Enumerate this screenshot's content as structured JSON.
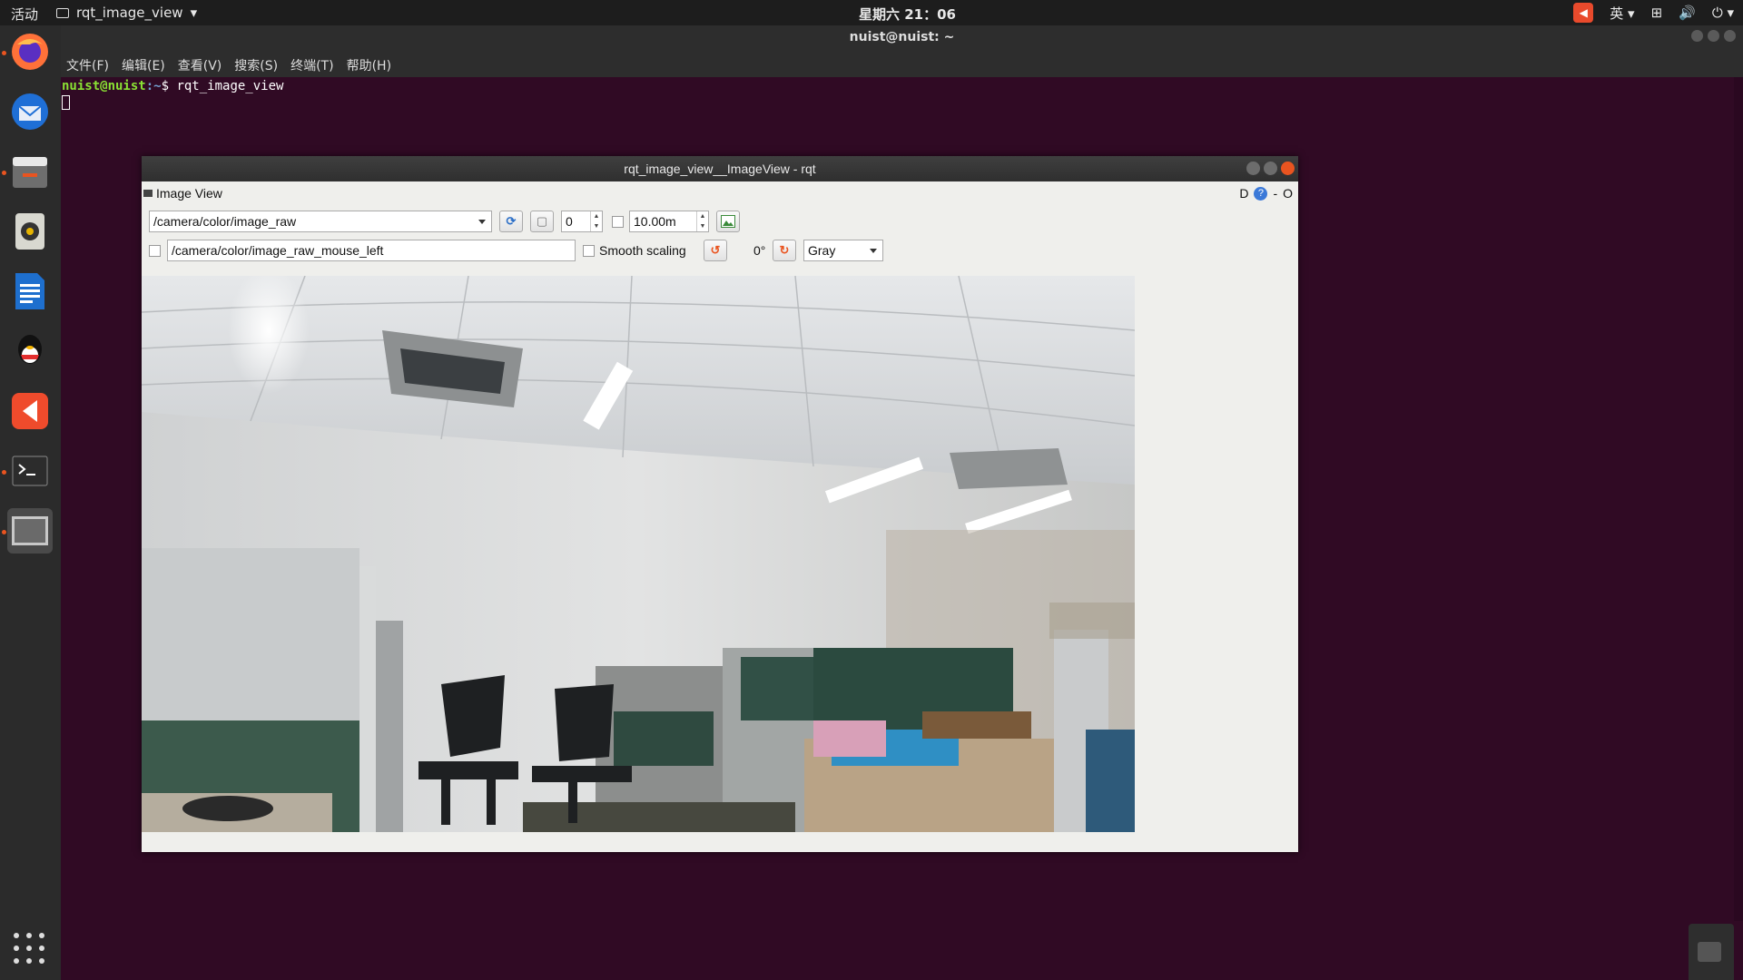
{
  "topbar": {
    "activities": "活动",
    "app_name": "rqt_image_view",
    "app_arrow": "▾",
    "clock": "星期六 21：06",
    "input_method": "英",
    "input_method_arrow": "▾",
    "icons": [
      "app-indicator-icon",
      "network-icon",
      "volume-icon",
      "power-icon"
    ]
  },
  "dock": {
    "items": [
      "firefox",
      "thunderbird",
      "files",
      "rhythmbox",
      "writer",
      "qq",
      "app-store",
      "terminal",
      "screen"
    ]
  },
  "terminal": {
    "window_title": "nuist@nuist: ~",
    "menu": [
      "文件(F)",
      "编辑(E)",
      "查看(V)",
      "搜索(S)",
      "终端(T)",
      "帮助(H)"
    ],
    "prompt_user": "nuist@nuist",
    "prompt_path": ":~",
    "prompt_symbol": "$ ",
    "command": "rqt_image_view"
  },
  "rqt": {
    "title": "rqt_image_view__ImageView - rqt",
    "plugin_name": "Image View",
    "dock_right_d": "D",
    "dock_right_help": "?",
    "dock_right_min": "-",
    "dock_right_o": "O",
    "topic": "/camera/color/image_raw",
    "spin_value": "0",
    "max_range": "10.00m",
    "mouse_topic": "/camera/color/image_raw_mouse_left",
    "smooth_scaling": "Smooth scaling",
    "rotation": "0°",
    "color_scheme": "Gray"
  },
  "colors": {
    "terminal_bg": "#300a24",
    "accent": "#e95420"
  }
}
